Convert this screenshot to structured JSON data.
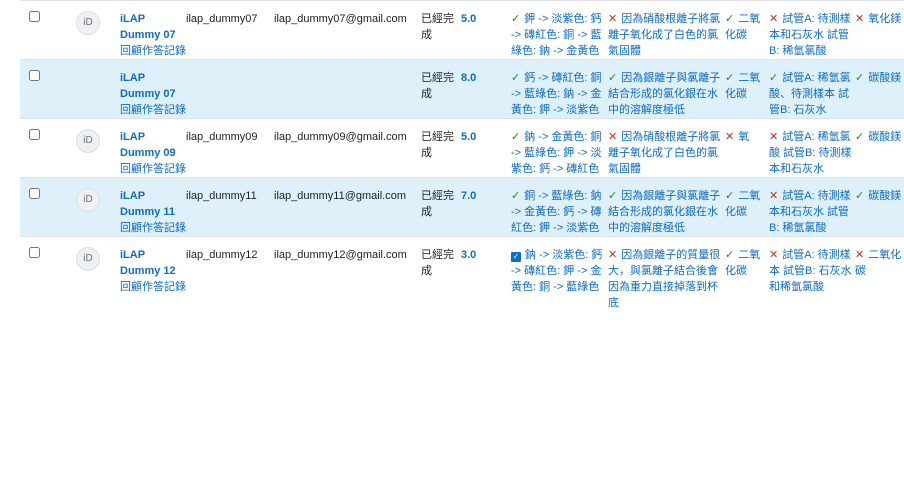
{
  "icons": {
    "correct": "check-icon",
    "incorrect": "cross-icon",
    "partial": "checkbox-checked-icon"
  },
  "colors": {
    "link": "#0f6cbf",
    "correct": "#357a32",
    "incorrect": "#ca3120",
    "shaded_row": "#def0f9"
  },
  "rows": [
    {
      "avatar": "iD",
      "name": "iLAP Dummy 07",
      "review": "回顧作答記錄",
      "username": "ilap_dummy07",
      "email": "ilap_dummy07@gmail.com",
      "state": "已經完成",
      "grade": "5.0",
      "r1": {
        "status": "correct",
        "text": "鉀 -> 淡紫色: 鈣 -> 磚紅色: 銅 -> 藍綠色: 鈉 -> 金黃色"
      },
      "r2": {
        "status": "incorrect",
        "text": "因為硝酸根離子將氯離子氧化成了白色的氯氣固體"
      },
      "r3": {
        "status": "correct",
        "text": "二氧化碳"
      },
      "r4": {
        "status": "incorrect",
        "text": "試管A: 待測樣本和石灰水 試管B: 稀氫氯酸"
      },
      "r5": {
        "status": "incorrect",
        "text": "氧化鎂"
      }
    },
    {
      "avatar": "",
      "name": "iLAP Dummy 07",
      "review": "回顧作答記錄",
      "username": "",
      "email": "",
      "state": "已經完成",
      "grade": "8.0",
      "r1": {
        "status": "correct",
        "text": "鈣 -> 磚紅色: 銅 -> 藍綠色: 鈉 -> 金黃色: 鉀 -> 淡紫色"
      },
      "r2": {
        "status": "correct",
        "text": "因為銀離子與氯離子 結合形成的氯化銀在水中的溶解度極低"
      },
      "r3": {
        "status": "correct",
        "text": "二氧化碳"
      },
      "r4": {
        "status": "correct",
        "text": "試管A: 稀氫氯酸、待測樣本 試管B: 石灰水"
      },
      "r5": {
        "status": "correct",
        "text": "碳酸鎂"
      }
    },
    {
      "avatar": "iD",
      "name": "iLAP Dummy 09",
      "review": "回顧作答記錄",
      "username": "ilap_dummy09",
      "email": "ilap_dummy09@gmail.com",
      "state": "已經完成",
      "grade": "5.0",
      "r1": {
        "status": "correct",
        "text": "鈉 -> 金黃色: 銅 -> 藍綠色: 鉀 -> 淡紫色: 鈣 -> 磚紅色"
      },
      "r2": {
        "status": "incorrect",
        "text": "因為硝酸根離子將氯離子氧化成了白色的氯氣固體"
      },
      "r3": {
        "status": "incorrect",
        "text": "氧"
      },
      "r4": {
        "status": "incorrect",
        "text": "試管A: 稀氫氯酸 試管B: 待測樣本和石灰水"
      },
      "r5": {
        "status": "correct",
        "text": "碳酸鎂"
      }
    },
    {
      "avatar": "iD",
      "name": "iLAP Dummy 11",
      "review": "回顧作答記錄",
      "username": "ilap_dummy11",
      "email": "ilap_dummy11@gmail.com",
      "state": "已經完成",
      "grade": "7.0",
      "r1": {
        "status": "correct",
        "text": "銅 -> 藍綠色: 鈉 -> 金黃色: 鈣 -> 磚紅色: 鉀 -> 淡紫色"
      },
      "r2": {
        "status": "correct",
        "text": "因為銀離子與氯離子 結合形成的氯化銀在水中的溶解度極低"
      },
      "r3": {
        "status": "correct",
        "text": "二氧化碳"
      },
      "r4": {
        "status": "incorrect",
        "text": "試管A: 待測樣本和石灰水 試管B: 稀氫氯酸"
      },
      "r5": {
        "status": "correct",
        "text": "碳酸鎂"
      }
    },
    {
      "avatar": "iD",
      "name": "iLAP Dummy 12",
      "review": "回顧作答記錄",
      "username": "ilap_dummy12",
      "email": "ilap_dummy12@gmail.com",
      "state": "已經完成",
      "grade": "3.0",
      "r1": {
        "status": "partial",
        "text": "鈉 -> 淡紫色: 鈣 -> 磚紅色: 鉀 -> 金黃色: 銅 -> 藍綠色"
      },
      "r2": {
        "status": "incorrect",
        "text": "因為銀離子的質量很大，與氯離子結合後會因為重力直接掉落到杯底"
      },
      "r3": {
        "status": "correct",
        "text": "二氧化碳"
      },
      "r4": {
        "status": "incorrect",
        "text": "試管A: 待測樣本 試管B: 石灰水和稀氫氯酸"
      },
      "r5": {
        "status": "incorrect",
        "text": "二氧化碳"
      }
    }
  ]
}
